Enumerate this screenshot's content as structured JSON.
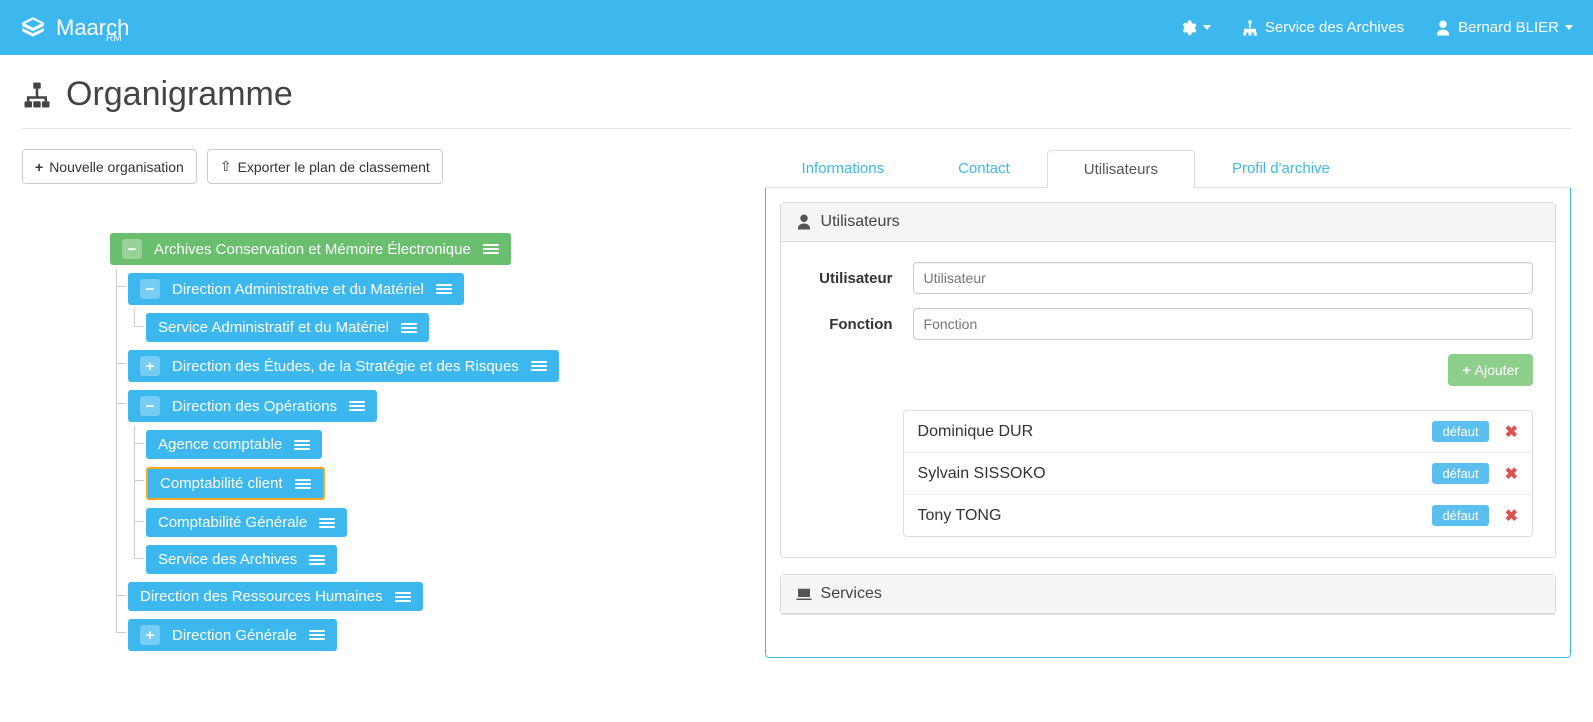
{
  "header": {
    "brand": "Maarch",
    "brand_sub": "RM",
    "service": "Service des Archives",
    "user": "Bernard BLIER"
  },
  "page": {
    "title": "Organigramme",
    "new_org_btn": "Nouvelle organisation",
    "export_btn": "Exporter le plan de classement"
  },
  "tree": {
    "root": {
      "label": "Archives Conservation et Mémoire Électronique",
      "toggle": "−"
    },
    "dir_admin": {
      "label": "Direction Administrative et du Matériel",
      "toggle": "−"
    },
    "svc_admin": {
      "label": "Service Administratif et du Matériel"
    },
    "dir_etudes": {
      "label": "Direction des Études, de la Stratégie et des Risques",
      "toggle": "+"
    },
    "dir_ops": {
      "label": "Direction des Opérations",
      "toggle": "−"
    },
    "agence_compta": {
      "label": "Agence comptable"
    },
    "compta_client": {
      "label": "Comptabilité client"
    },
    "compta_gen": {
      "label": "Comptabilité Générale"
    },
    "svc_archives": {
      "label": "Service des Archives"
    },
    "dir_rh": {
      "label": "Direction des Ressources Humaines"
    },
    "dir_gen": {
      "label": "Direction Générale",
      "toggle": "+"
    }
  },
  "tabs": {
    "informations": "Informations",
    "contact": "Contact",
    "utilisateurs": "Utilisateurs",
    "profil": "Profil d'archive"
  },
  "users_panel": {
    "title": "Utilisateurs",
    "user_label": "Utilisateur",
    "user_placeholder": "Utilisateur",
    "function_label": "Fonction",
    "function_placeholder": "Fonction",
    "add_btn": "Ajouter",
    "badge_default": "défaut",
    "list": [
      {
        "name": "Dominique DUR"
      },
      {
        "name": "Sylvain SISSOKO"
      },
      {
        "name": "Tony TONG"
      }
    ]
  },
  "services_panel": {
    "title": "Services"
  }
}
